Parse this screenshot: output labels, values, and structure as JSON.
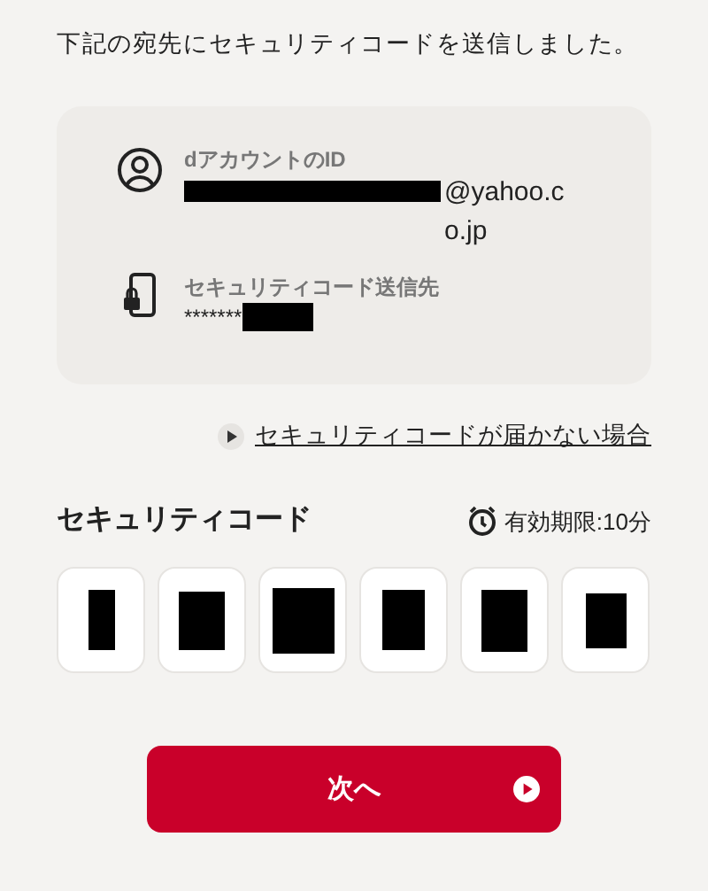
{
  "message": "下記の宛先にセキュリティコードを送信しました。",
  "destination": {
    "account_label": "dアカウントのID",
    "account_id": {
      "redacted": true,
      "visible_text": "@yahoo.co.jp"
    },
    "phone_label": "セキュリティコード送信先",
    "phone": {
      "redacted": true,
      "visible_text": "*******"
    }
  },
  "help_link": "セキュリティコードが届かない場合",
  "code_title": "セキュリティコード",
  "expiry": "有効期限:10分",
  "code_digits": [
    {
      "redacted": true
    },
    {
      "redacted": true
    },
    {
      "redacted": true
    },
    {
      "redacted": true
    },
    {
      "redacted": true
    },
    {
      "redacted": true
    }
  ],
  "next_button": "次へ"
}
